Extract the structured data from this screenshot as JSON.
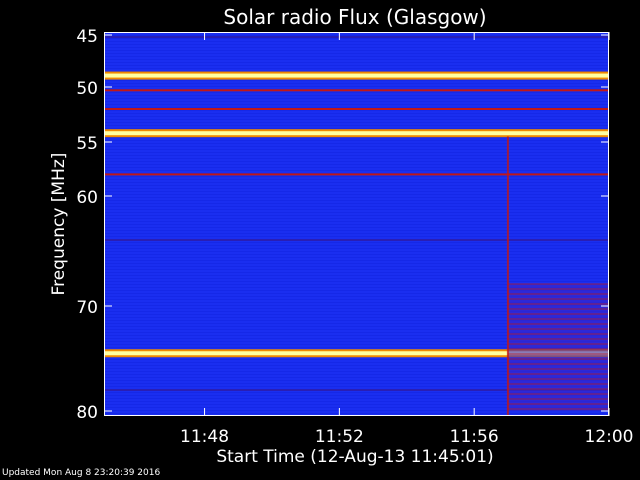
{
  "updated_text": "Updated Mon Aug  8 23:20:39 2016",
  "chart_data": {
    "type": "heatmap",
    "title": "Solar radio Flux (Glasgow)",
    "xlabel": "Start Time (12-Aug-13 11:45:01)",
    "ylabel": "Frequency [MHz]",
    "x_unit": "time",
    "xlim": [
      "11:45:01",
      "12:00:00"
    ],
    "ylim": [
      45,
      80
    ],
    "y_inverted": true,
    "x_ticks": [
      "11:48",
      "11:52",
      "11:56",
      "12:00"
    ],
    "y_ticks": [
      45,
      50,
      55,
      60,
      70,
      80
    ],
    "colors": {
      "background": "#1a2ef0",
      "weak": "#2a1eb4",
      "medium": "#c01818",
      "strong": "#f08a00",
      "peak": "#ffffa0"
    },
    "bands": [
      {
        "freq_mhz": 45.2,
        "level": "weak"
      },
      {
        "freq_mhz": 48.9,
        "level": "peak"
      },
      {
        "freq_mhz": 50.3,
        "level": "medium"
      },
      {
        "freq_mhz": 52.0,
        "level": "medium"
      },
      {
        "freq_mhz": 54.2,
        "level": "peak"
      },
      {
        "freq_mhz": 58.0,
        "level": "medium"
      },
      {
        "freq_mhz": 64.0,
        "level": "weak"
      },
      {
        "freq_mhz": 74.5,
        "level": "peak"
      },
      {
        "freq_mhz": 78.0,
        "level": "weak"
      }
    ],
    "activity_onset": "11:57:00",
    "activity_range_mhz": [
      68.0,
      80.0
    ]
  }
}
